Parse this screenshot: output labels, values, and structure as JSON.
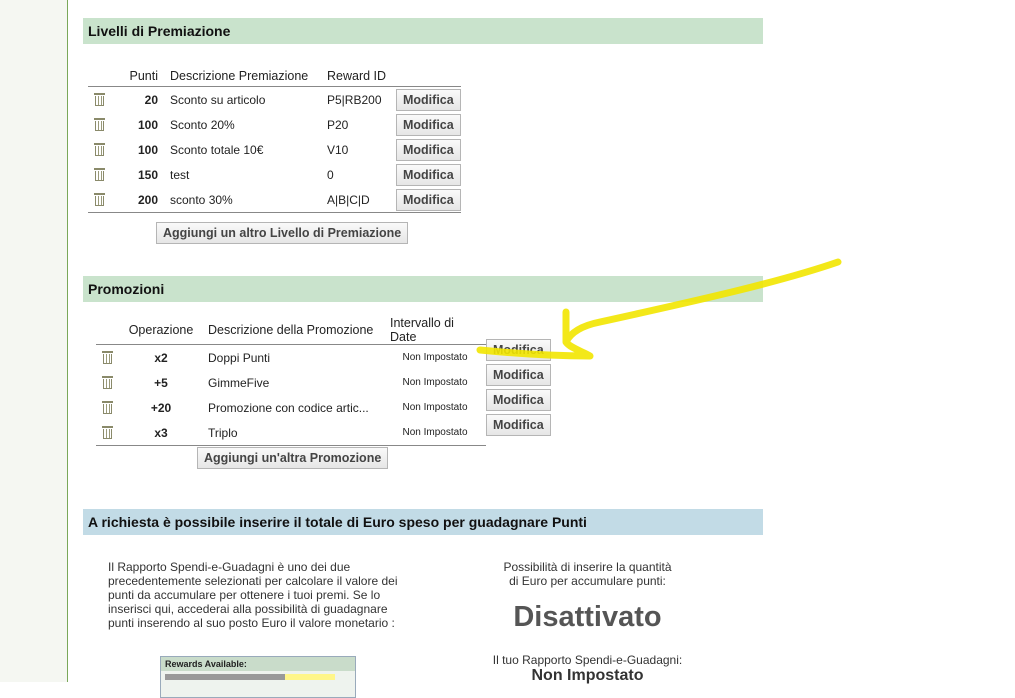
{
  "levels": {
    "title": "Livelli di Premiazione",
    "columns": [
      "Punti",
      "Descrizione Premiazione",
      "Reward ID"
    ],
    "rows": [
      {
        "points": "20",
        "description": "Sconto su articolo",
        "reward_id": "P5|RB200",
        "button": "Modifica"
      },
      {
        "points": "100",
        "description": "Sconto 20%",
        "reward_id": "P20",
        "button": "Modifica"
      },
      {
        "points": "100",
        "description": "Sconto totale 10€",
        "reward_id": "V10",
        "button": "Modifica"
      },
      {
        "points": "150",
        "description": "test",
        "reward_id": "0",
        "button": "Modifica"
      },
      {
        "points": "200",
        "description": "sconto 30%",
        "reward_id": "A|B|C|D",
        "button": "Modifica"
      }
    ],
    "add_button": "Aggiungi un altro Livello di Premiazione"
  },
  "promotions": {
    "title": "Promozioni",
    "columns": [
      "Operazione",
      "Descrizione della Promozione",
      "Intervallo di Date"
    ],
    "rows": [
      {
        "operation": "x2",
        "description": "Doppi Punti",
        "interval": "Non Impostato",
        "button": "Modifica"
      },
      {
        "operation": "+5",
        "description": "GimmeFive",
        "interval": "Non Impostato",
        "button": "Modifica"
      },
      {
        "operation": "+20",
        "description": "Promozione con codice artic...",
        "interval": "Non Impostato",
        "button": "Modifica"
      },
      {
        "operation": "x3",
        "description": "Triplo",
        "interval": "Non Impostato",
        "button": "Modifica"
      }
    ],
    "add_button": "Aggiungi un'altra Promozione"
  },
  "euro_section": {
    "title": "A richiesta è possibile inserire il totale di Euro speso per guadagnare Punti",
    "left_text_lines": [
      "Il Rapporto Spendi-e-Guadagni è uno dei due",
      "precedentemente selezionati per calcolare il valore dei",
      "punti da accumulare per ottenere i tuoi premi. Se lo",
      "inserisci qui, accederai alla possibilità di guadagnare",
      "punti inserendo al suo posto Euro il valore monetario :"
    ],
    "right_text_lines": [
      "Possibilità di inserire la quantità",
      "di Euro per accumulare punti:"
    ],
    "status": "Disattivato",
    "ratio_label": "Il tuo Rapporto Spendi-e-Guadagni:",
    "ratio_value": "Non Impostato",
    "rewards_box_title": "Rewards Available:"
  },
  "colors": {
    "levels_header": "#c9e3cc",
    "euro_header": "#c2dbe6",
    "annotation": "#f2e600"
  },
  "icons": [
    "trash-icon"
  ]
}
